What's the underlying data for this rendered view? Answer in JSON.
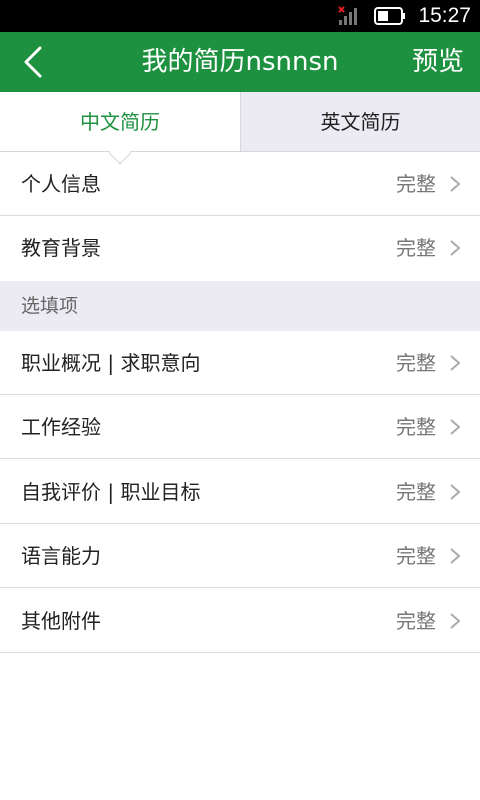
{
  "status_bar": {
    "time": "15:27"
  },
  "app_bar": {
    "title": "我的简历nsnnsn",
    "preview": "预览"
  },
  "tabs": [
    {
      "label": "中文简历",
      "selected": true
    },
    {
      "label": "英文简历",
      "selected": false
    }
  ],
  "required_items": [
    {
      "label": "个人信息",
      "status": "完整"
    },
    {
      "label": "教育背景",
      "status": "完整"
    }
  ],
  "optional_section": {
    "label": "选填项"
  },
  "optional_items": [
    {
      "label": "职业概况 | 求职意向",
      "status": "完整"
    },
    {
      "label": "工作经验",
      "status": "完整"
    },
    {
      "label": "自我评价 | 职业目标",
      "status": "完整"
    },
    {
      "label": "语言能力",
      "status": "完整"
    },
    {
      "label": "其他附件",
      "status": "完整"
    }
  ],
  "colors": {
    "accent": "#1e9140",
    "section_bg": "#ecebf3"
  }
}
